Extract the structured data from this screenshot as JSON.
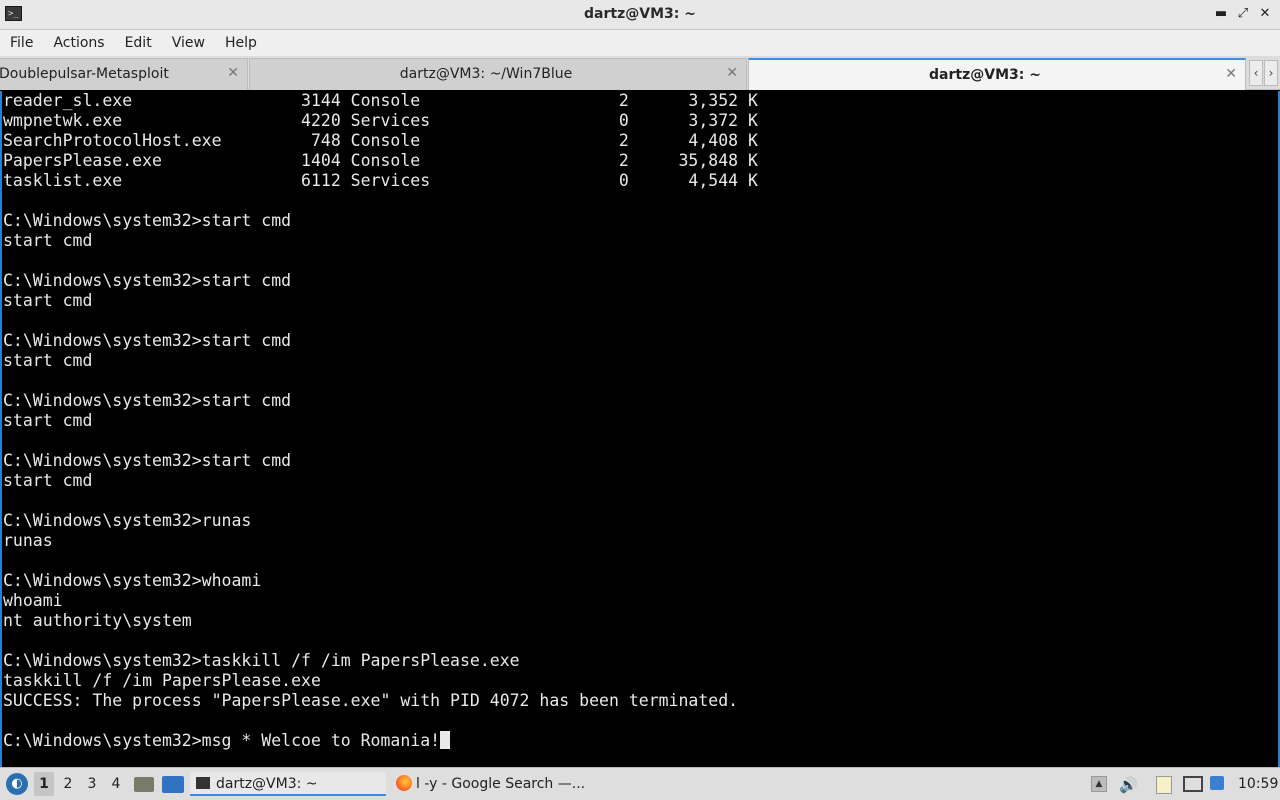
{
  "window": {
    "title": "dartz@VM3: ~",
    "controls": {
      "minimize": "▬",
      "restore": "⤢",
      "close": "✕"
    }
  },
  "menu": [
    "File",
    "Actions",
    "Edit",
    "View",
    "Help"
  ],
  "tabs": [
    {
      "label": "Doublepulsar-Metasploit",
      "close": "✕",
      "active": false
    },
    {
      "label": "dartz@VM3: ~/Win7Blue",
      "close": "✕",
      "active": false
    },
    {
      "label": "dartz@VM3: ~",
      "close": "✕",
      "active": true
    }
  ],
  "tab_scroll": {
    "left": "‹",
    "right": "›"
  },
  "terminal": {
    "lines": [
      "reader_sl.exe                 3144 Console                    2      3,352 K",
      "wmpnetwk.exe                  4220 Services                   0      3,372 K",
      "SearchProtocolHost.exe         748 Console                    2      4,408 K",
      "PapersPlease.exe              1404 Console                    2     35,848 K",
      "tasklist.exe                  6112 Services                   0      4,544 K",
      "",
      "C:\\Windows\\system32>start cmd",
      "start cmd",
      "",
      "C:\\Windows\\system32>start cmd",
      "start cmd",
      "",
      "C:\\Windows\\system32>start cmd",
      "start cmd",
      "",
      "C:\\Windows\\system32>start cmd",
      "start cmd",
      "",
      "C:\\Windows\\system32>start cmd",
      "start cmd",
      "",
      "C:\\Windows\\system32>runas",
      "runas",
      "",
      "C:\\Windows\\system32>whoami",
      "whoami",
      "nt authority\\system",
      "",
      "C:\\Windows\\system32>taskkill /f /im PapersPlease.exe",
      "taskkill /f /im PapersPlease.exe",
      "SUCCESS: The process \"PapersPlease.exe\" with PID 4072 has been terminated.",
      ""
    ],
    "prompt_line": "C:\\Windows\\system32>msg * Welcoe to Romania!"
  },
  "taskbar": {
    "start_icon": "start-menu-icon",
    "workspaces": [
      "1",
      "2",
      "3",
      "4"
    ],
    "active_workspace": "1",
    "tasks": [
      {
        "label": "dartz@VM3: ~",
        "icon": "terminal-icon",
        "active": true
      },
      {
        "label": "l -y - Google Search —...",
        "icon": "firefox-icon",
        "active": false
      }
    ],
    "clock": "10:59"
  }
}
